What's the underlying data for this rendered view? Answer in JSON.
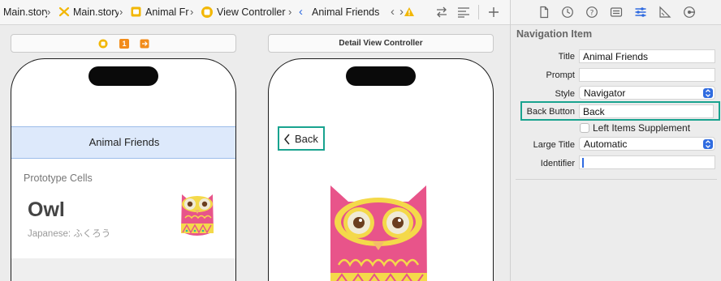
{
  "jumpbar": {
    "crumbs": [
      "Main.story",
      "Main.story",
      "Animal Fri",
      "View Controller",
      "Animal Friends"
    ]
  },
  "canvas": {
    "detail_scene_title": "Detail View Controller",
    "scene_badge_number": "1",
    "nav_title": "Animal Friends",
    "prototype_cells_label": "Prototype Cells",
    "cell_title": "Owl",
    "cell_subtitle": "Japanese: ふくろう",
    "back_label": "Back"
  },
  "inspector": {
    "title": "Navigation Item",
    "fields": {
      "title_label": "Title",
      "title_value": "Animal Friends",
      "prompt_label": "Prompt",
      "prompt_value": "",
      "style_label": "Style",
      "style_value": "Navigator",
      "back_button_label": "Back Button",
      "back_button_value": "Back",
      "left_items_label": "Left Items Supplement",
      "left_items_checked": false,
      "large_title_label": "Large Title",
      "large_title_value": "Automatic",
      "identifier_label": "Identifier",
      "identifier_value": ""
    }
  },
  "colors": {
    "accent_teal": "#19a38f",
    "nav_bar_bg": "#dde9fb",
    "scene_yellow": "#f2b705",
    "scene_orange": "#f28c1a",
    "popup_blue": "#2f6be0",
    "owl_pink": "#e8548a",
    "owl_yellow": "#f4d94a"
  },
  "icons": [
    "chevron-right-icon",
    "storyboard-icon",
    "view-controller-icon",
    "back-chevron-icon",
    "forward-chevron-icon",
    "warning-icon",
    "related-items-icon",
    "lines-icon",
    "add-icon",
    "file-icon",
    "history-icon",
    "help-icon",
    "identity-icon",
    "attributes-icon",
    "size-icon",
    "connections-icon"
  ]
}
